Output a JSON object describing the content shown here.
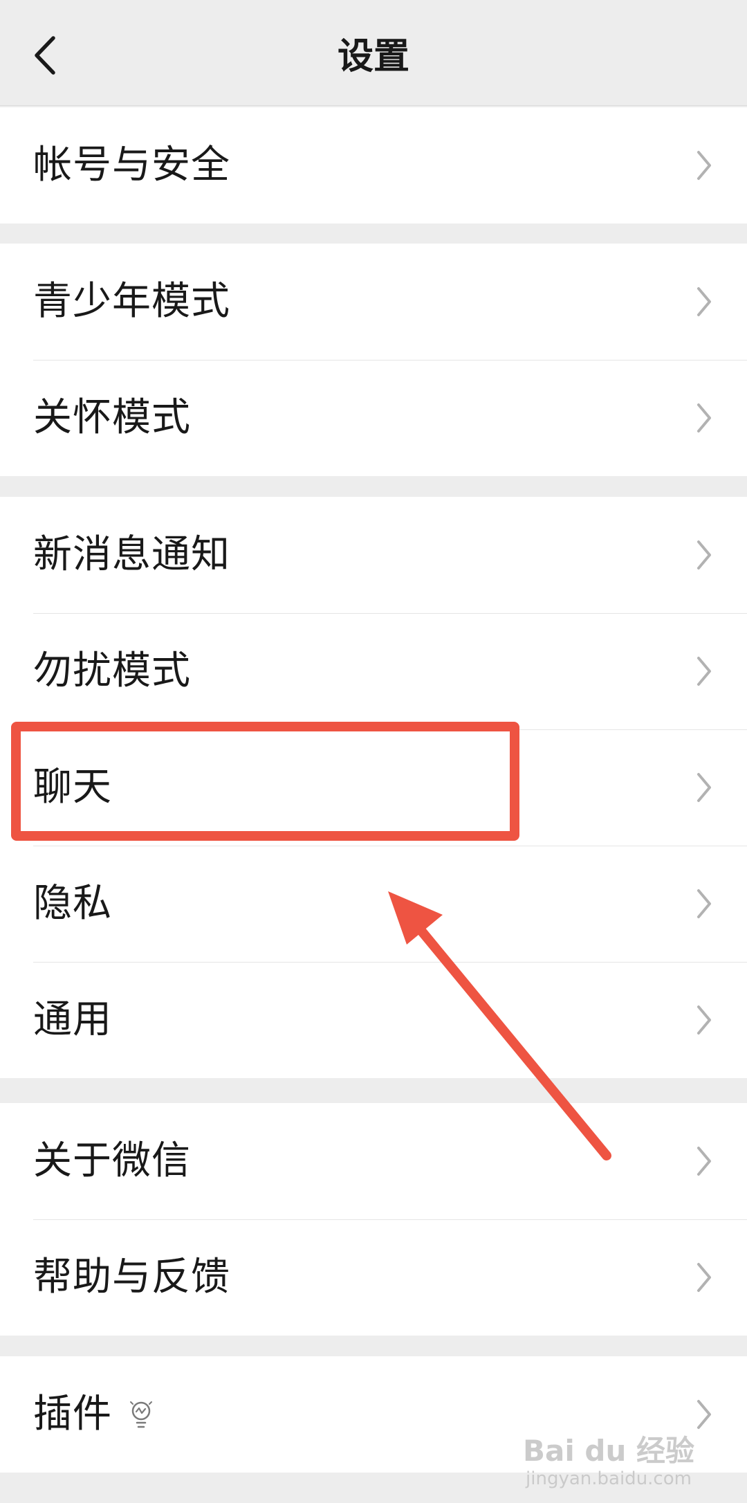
{
  "header": {
    "title": "设置"
  },
  "groups": [
    {
      "items": [
        {
          "label": "帐号与安全"
        }
      ]
    },
    {
      "items": [
        {
          "label": "青少年模式"
        },
        {
          "label": "关怀模式"
        }
      ]
    },
    {
      "items": [
        {
          "label": "新消息通知"
        },
        {
          "label": "勿扰模式"
        },
        {
          "label": "聊天"
        },
        {
          "label": "隐私"
        },
        {
          "label": "通用"
        }
      ]
    },
    {
      "items": [
        {
          "label": "关于微信"
        },
        {
          "label": "帮助与反馈"
        }
      ]
    },
    {
      "items": [
        {
          "label": "插件"
        }
      ]
    }
  ],
  "colors": {
    "annotation": "#ee5442",
    "background": "#ededed",
    "cell": "#ffffff",
    "chevron": "#b2b2b2"
  },
  "watermark": {
    "brand": "Bai du 经验",
    "url": "jingyan.baidu.com"
  }
}
